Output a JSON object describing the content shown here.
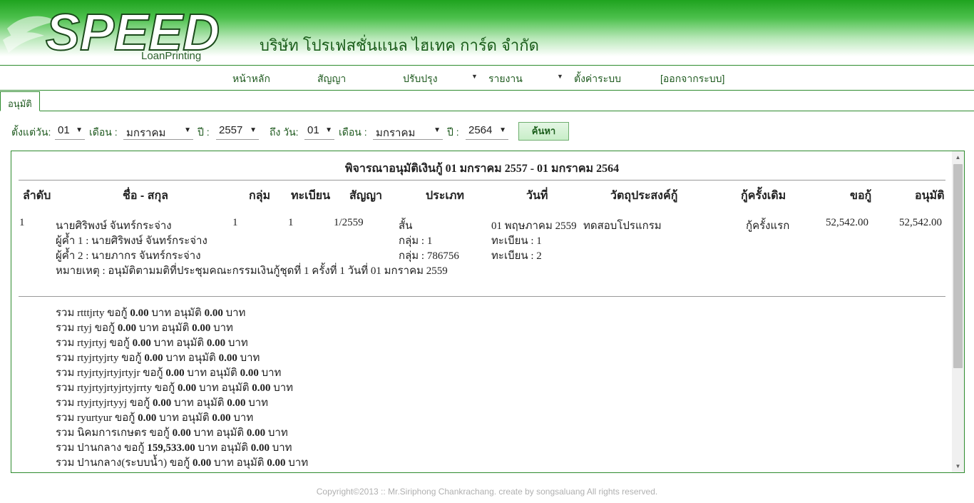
{
  "header": {
    "logo_text": "SPEED",
    "logo_sub": "LoanPrinting",
    "company_name": "บริษัท โปรเฟสชั่นแนล ไฮเทค การ์ด จำกัด"
  },
  "menu": {
    "home": "หน้าหลัก",
    "contract": "สัญญา",
    "update": "ปรับปรุง",
    "report": "รายงาน",
    "settings": "ตั้งค่าระบบ",
    "logout": "[ออกจากระบบ]"
  },
  "tab": {
    "label": "อนุมัติ"
  },
  "filter": {
    "from_day_label": "ตั้งแต่วัน:",
    "from_day": "01",
    "month_label": "เดือน :",
    "from_month": "มกราคม",
    "year_label": "ปี :",
    "from_year": "2557",
    "to_day_label": "ถึง วัน:",
    "to_day": "01",
    "to_month": "มกราคม",
    "to_year": "2564",
    "search_label": "ค้นหา"
  },
  "report": {
    "title": "พิจารณาอนุมัติเงินกู้ 01 มกราคม 2557 - 01 มกราคม 2564",
    "columns": {
      "no": "ลำดับ",
      "name": "ชื่อ - สกุล",
      "group": "กลุ่ม",
      "register": "ทะเบียน",
      "contract": "สัญญา",
      "type": "ประเภท",
      "date": "วันที่",
      "purpose": "วัตถุประสงค์กู้",
      "previous": "กู้ครั้งเดิม",
      "request": "ขอกู้",
      "approve": "อนุมัติ"
    },
    "row": {
      "no": "1",
      "name": "นายศิริพงษ์ จันทร์กระจ่าง",
      "guarantor1": "ผู้ค้ำ 1 : นายศิริพงษ์ จันทร์กระจ่าง",
      "guarantor2": "ผู้ค้ำ 2 : นายภากร จันทร์กระจ่าง",
      "note": "หมายเหตุ : อนุมัติตามมติที่ประชุมคณะกรรมเงินกู้ชุดที่ 1 ครั้งที่ 1 วันที่ 01 มกราคม 2559",
      "group": "1",
      "register": "1",
      "contract": "1/2559",
      "type": "สั้น",
      "type_group": "กลุ่ม : 1",
      "type_group2": "กลุ่ม : 786756",
      "date": "01 พฤษภาคม 2559",
      "date_reg1": "ทะเบียน : 1",
      "date_reg2": "ทะเบียน : 2",
      "purpose": "ทดสอบโปรแกรม",
      "previous": "กู้ครั้งแรก",
      "request": "52,542.00",
      "approve": "52,542.00"
    },
    "summary_words": {
      "total": "รวม",
      "request": "ขอกู้",
      "baht": "บาท",
      "approve": "อนุมัติ"
    },
    "summaries": [
      {
        "name": "rtttjrty",
        "request": "0.00",
        "approve": "0.00"
      },
      {
        "name": "rtyj",
        "request": "0.00",
        "approve": "0.00"
      },
      {
        "name": "rtyjrtyj",
        "request": "0.00",
        "approve": "0.00"
      },
      {
        "name": "rtyjrtyjrty",
        "request": "0.00",
        "approve": "0.00"
      },
      {
        "name": "rtyjrtyjrtyjrtyjr",
        "request": "0.00",
        "approve": "0.00"
      },
      {
        "name": "rtyjrtyjrtyjrtyjrrty",
        "request": "0.00",
        "approve": "0.00"
      },
      {
        "name": "rtyjrtyjrtyyj",
        "request": "0.00",
        "approve": "0.00"
      },
      {
        "name": "ryurtyur",
        "request": "0.00",
        "approve": "0.00"
      },
      {
        "name": "นิคมการเกษตร",
        "request": "0.00",
        "approve": "0.00"
      },
      {
        "name": "ปานกลาง",
        "request": "159,533.00",
        "approve": "0.00"
      },
      {
        "name": "ปานกลาง(ระบบน้ำ)",
        "request": "0.00",
        "approve": "0.00"
      }
    ]
  },
  "footer": {
    "copyright": "Copyright©2013 :: Mr.Siriphong Chankrachang. create by songsaluang All rights reserved."
  }
}
